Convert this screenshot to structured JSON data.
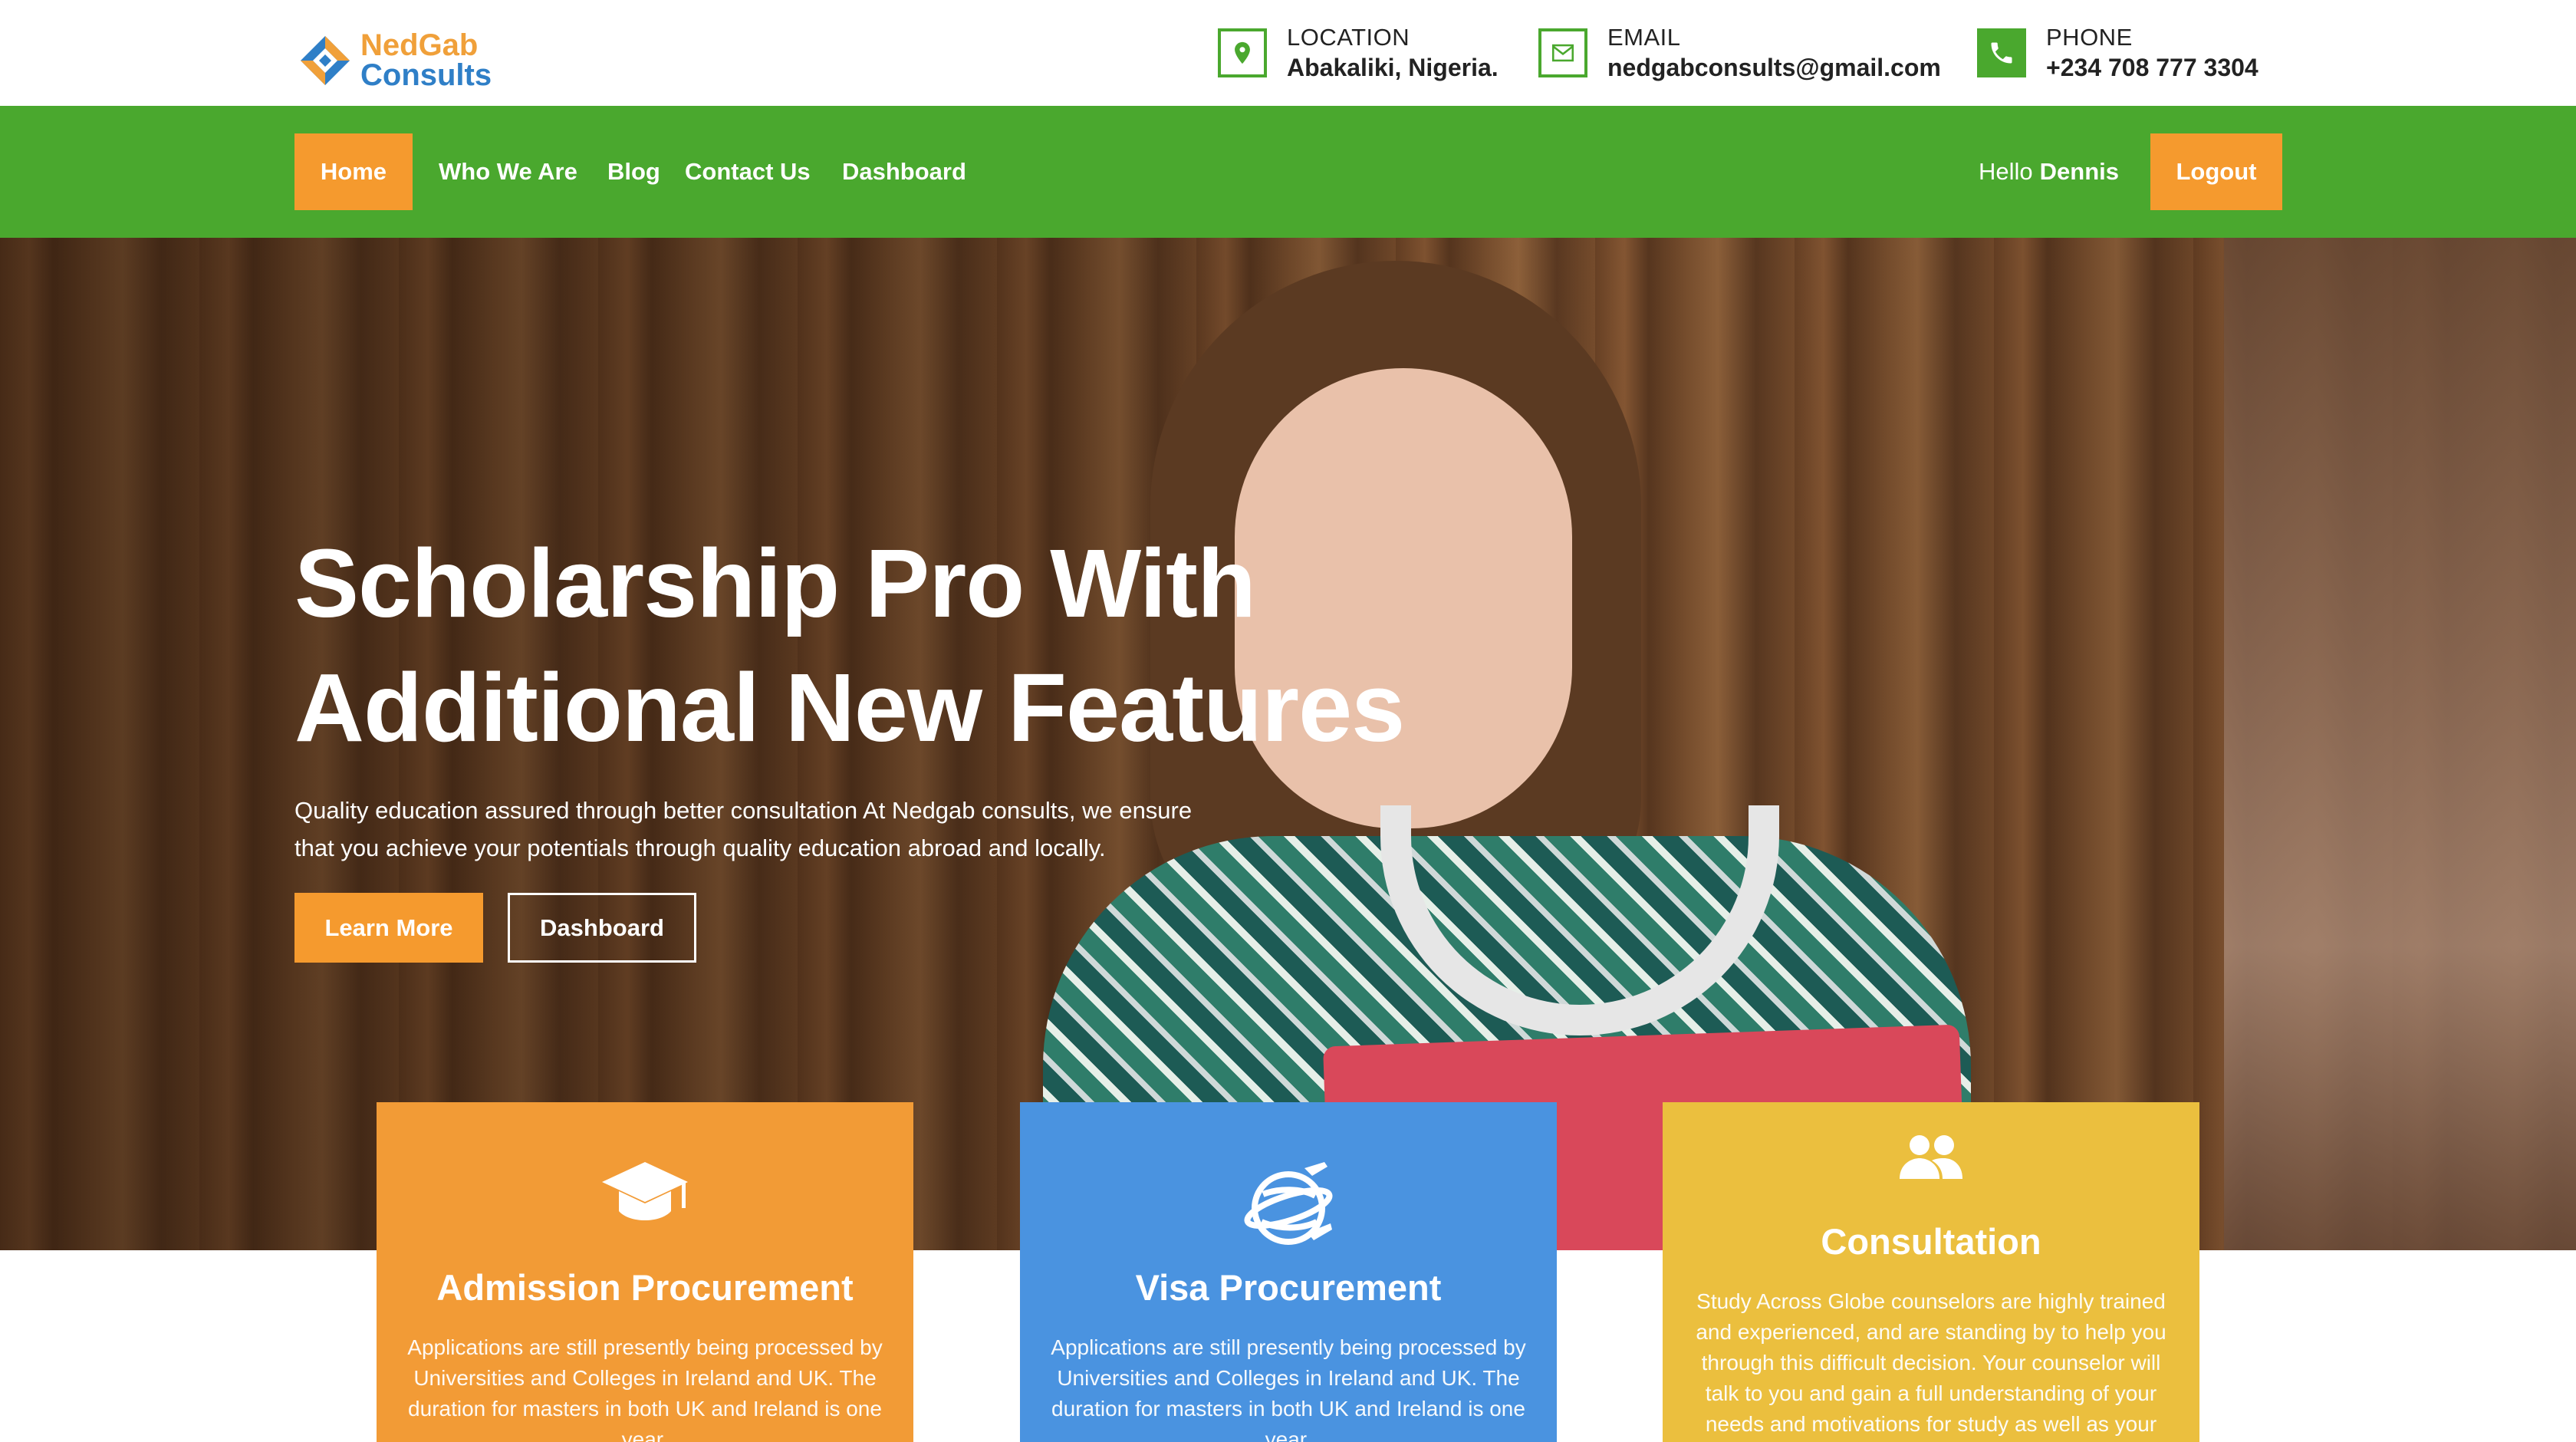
{
  "brand": {
    "line1": "NedGab",
    "line2": "Consults",
    "colors": {
      "orange": "#f0a03a",
      "blue": "#2f7fc7"
    }
  },
  "contacts": [
    {
      "icon": "map-pin-icon",
      "label": "LOCATION",
      "value": "Abakaliki, Nigeria."
    },
    {
      "icon": "mail-icon",
      "label": "EMAIL",
      "value": "nedgabconsults@gmail.com"
    },
    {
      "icon": "phone-icon",
      "label": "PHONE",
      "value": "+234 708 777 3304"
    }
  ],
  "nav": {
    "items": [
      {
        "label": "Home",
        "active": true
      },
      {
        "label": "Who We Are"
      },
      {
        "label": "Blog"
      },
      {
        "label": "Contact Us"
      },
      {
        "label": "Dashboard"
      }
    ],
    "greeting": "Hello",
    "user": "Dennis",
    "logout": "Logout",
    "colors": {
      "bar": "#4aa82e",
      "accent": "#f59a2e"
    }
  },
  "hero": {
    "title_line1": "Scholarship Pro With",
    "title_line2": "Additional New Features",
    "subtitle_line1": "Quality education assured through better consultation At Nedgab consults, we ensure",
    "subtitle_line2": "that you achieve your potentials through quality education abroad and locally.",
    "buttons": {
      "primary": "Learn More",
      "secondary": "Dashboard"
    }
  },
  "services": [
    {
      "icon": "graduation-cap-icon",
      "title": "Admission Procurement",
      "description": "Applications are still presently being processed by Universities and Colleges in Ireland and UK. The duration for masters in both UK and Ireland is one year.",
      "color": "#f29b36"
    },
    {
      "icon": "globe-plane-icon",
      "title": "Visa Procurement",
      "description": "Applications are still presently being processed by Universities and Colleges in Ireland and UK. The duration for masters in both UK and Ireland is one year.",
      "color": "#4a93e0"
    },
    {
      "icon": "users-icon",
      "title": "Consultation",
      "description": "Study Across Globe counselors are highly trained and experienced, and are standing by to help you through this difficult decision. Your counselor will talk to you and gain a full understanding of your needs and motivations for study as well as your",
      "color": "#ebbf3e"
    }
  ]
}
